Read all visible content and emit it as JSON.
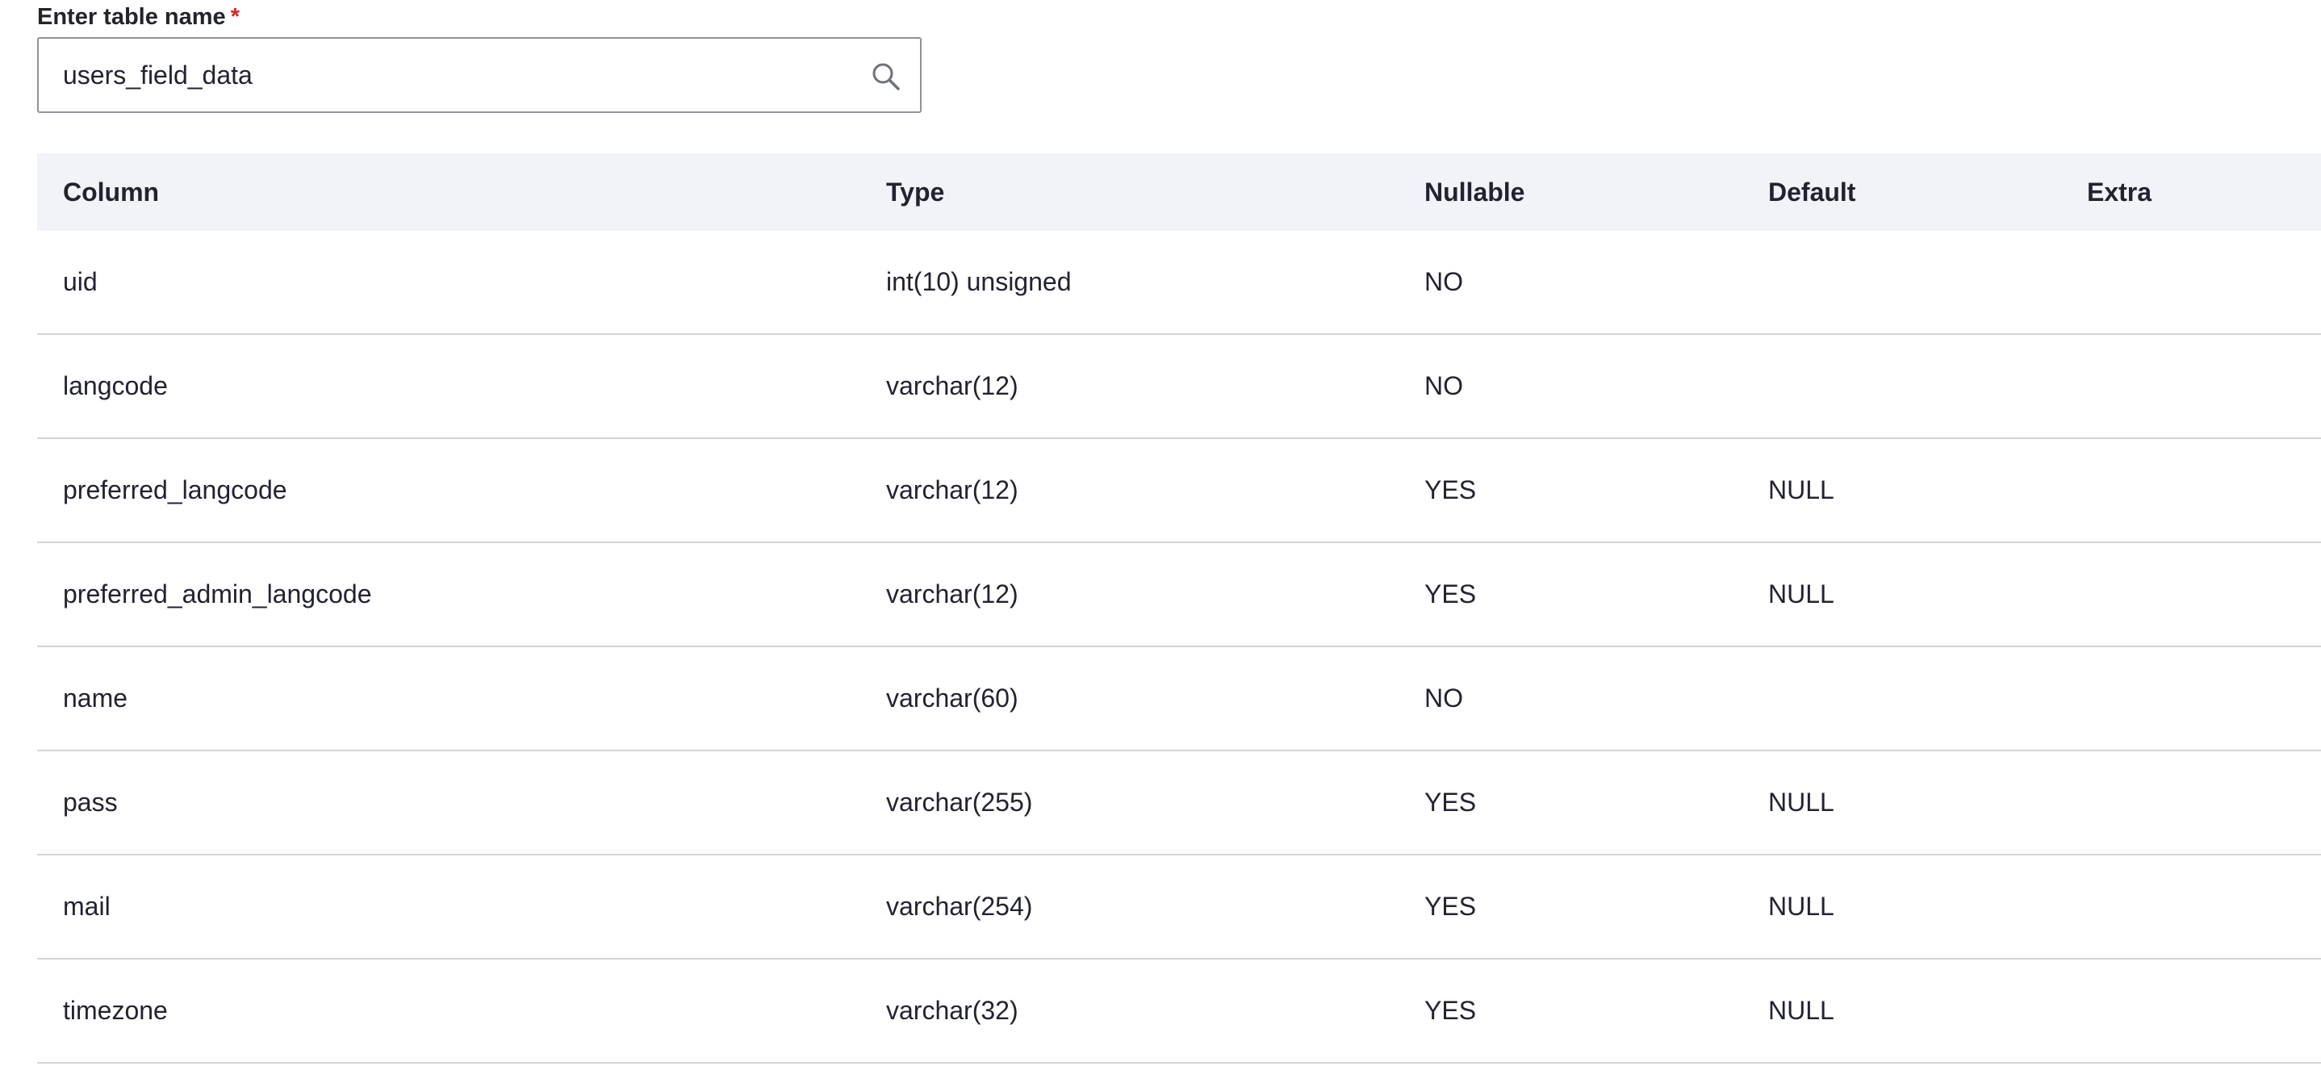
{
  "field": {
    "label": "Enter table name",
    "required_mark": "*",
    "value": "users_field_data",
    "icon": "search-icon"
  },
  "table": {
    "headers": {
      "column": "Column",
      "type": "Type",
      "nullable": "Nullable",
      "default": "Default",
      "extra": "Extra"
    },
    "rows": [
      {
        "column": "uid",
        "type": "int(10) unsigned",
        "nullable": "NO",
        "default": "",
        "extra": ""
      },
      {
        "column": "langcode",
        "type": "varchar(12)",
        "nullable": "NO",
        "default": "",
        "extra": ""
      },
      {
        "column": "preferred_langcode",
        "type": "varchar(12)",
        "nullable": "YES",
        "default": "NULL",
        "extra": ""
      },
      {
        "column": "preferred_admin_langcode",
        "type": "varchar(12)",
        "nullable": "YES",
        "default": "NULL",
        "extra": ""
      },
      {
        "column": "name",
        "type": "varchar(60)",
        "nullable": "NO",
        "default": "",
        "extra": ""
      },
      {
        "column": "pass",
        "type": "varchar(255)",
        "nullable": "YES",
        "default": "NULL",
        "extra": ""
      },
      {
        "column": "mail",
        "type": "varchar(254)",
        "nullable": "YES",
        "default": "NULL",
        "extra": ""
      },
      {
        "column": "timezone",
        "type": "varchar(32)",
        "nullable": "YES",
        "default": "NULL",
        "extra": ""
      }
    ]
  },
  "colors": {
    "header_background": "#f2f3f8",
    "row_divider": "#d3d4d9",
    "required": "#d72222",
    "input_border": "#8e929c"
  }
}
